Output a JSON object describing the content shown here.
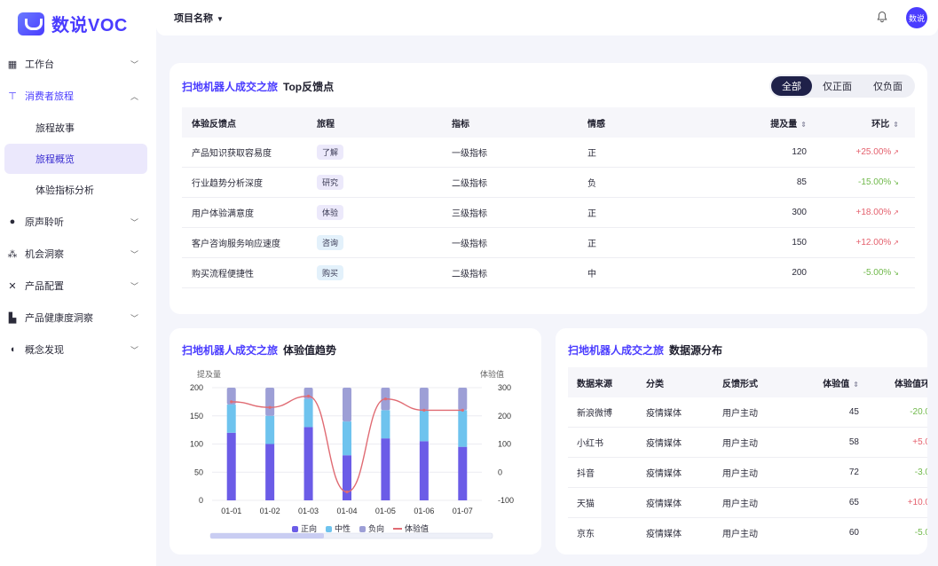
{
  "app": {
    "logo_text": "数说VOC"
  },
  "header": {
    "project_label": "项目名称",
    "avatar_text": "数说"
  },
  "sidebar": {
    "items": [
      {
        "label": "工作台",
        "icon": "dashboard-icon"
      },
      {
        "label": "消费者旅程",
        "icon": "signpost-icon",
        "expanded": true,
        "children": [
          {
            "label": "旅程故事"
          },
          {
            "label": "旅程概览",
            "active": true
          },
          {
            "label": "体验指标分析"
          }
        ]
      },
      {
        "label": "原声聆听",
        "icon": "chat-icon"
      },
      {
        "label": "机会洞察",
        "icon": "network-icon"
      },
      {
        "label": "产品配置",
        "icon": "tools-icon"
      },
      {
        "label": "产品健康度洞察",
        "icon": "building-icon"
      },
      {
        "label": "概念发现",
        "icon": "bulb-icon"
      }
    ]
  },
  "feedback_card": {
    "title_highlight": "扫地机器人成交之旅",
    "title_rest": "Top反馈点",
    "filters": [
      "全部",
      "仅正面",
      "仅负面"
    ],
    "active_filter": "全部",
    "columns": [
      "体验反馈点",
      "旅程",
      "指标",
      "情感",
      "提及量",
      "环比"
    ],
    "rows": [
      {
        "point": "产品知识获取容易度",
        "journey": "了解",
        "metric": "一级指标",
        "sentiment": "正",
        "mentions": "120",
        "mom": "+25.00%",
        "dir": "up"
      },
      {
        "point": "行业趋势分析深度",
        "journey": "研究",
        "metric": "二级指标",
        "sentiment": "负",
        "mentions": "85",
        "mom": "-15.00%",
        "dir": "down"
      },
      {
        "point": "用户体验满意度",
        "journey": "体验",
        "metric": "三级指标",
        "sentiment": "正",
        "mentions": "300",
        "mom": "+18.00%",
        "dir": "up"
      },
      {
        "point": "客户咨询服务响应速度",
        "journey": "咨询",
        "metric": "一级指标",
        "sentiment": "正",
        "mentions": "150",
        "mom": "+12.00%",
        "dir": "up"
      },
      {
        "point": "购买流程便捷性",
        "journey": "购买",
        "metric": "二级指标",
        "sentiment": "中",
        "mentions": "200",
        "mom": "-5.00%",
        "dir": "down"
      }
    ]
  },
  "trend_card": {
    "title_highlight": "扫地机器人成交之旅",
    "title_rest": "体验值趋势"
  },
  "chart_data": {
    "type": "bar",
    "stacked": true,
    "categories": [
      "01-01",
      "01-02",
      "01-03",
      "01-04",
      "01-05",
      "01-06",
      "01-07"
    ],
    "series": [
      {
        "name": "正向",
        "values": [
          120,
          100,
          130,
          80,
          110,
          105,
          95
        ],
        "color": "#6b5ce7"
      },
      {
        "name": "中性",
        "values": [
          50,
          50,
          50,
          60,
          50,
          55,
          65
        ],
        "color": "#6ec3ee"
      },
      {
        "name": "负向",
        "values": [
          30,
          50,
          20,
          60,
          40,
          40,
          40
        ],
        "color": "#9d9fd6"
      },
      {
        "name": "体验值",
        "type": "line",
        "axis": "right",
        "values": [
          250,
          230,
          270,
          -70,
          260,
          220,
          220
        ],
        "color": "#e06b73"
      }
    ],
    "ylabel": "提及量",
    "ylabel_right": "体验值",
    "ylim": [
      0,
      200
    ],
    "ylim_right": [
      -100,
      300
    ],
    "yticks": [
      "0",
      "50",
      "100",
      "150",
      "200"
    ],
    "yticks_right": [
      "-100",
      "0",
      "100",
      "200",
      "300"
    ],
    "grid": true,
    "legend": "bottom"
  },
  "source_card": {
    "title_highlight": "扫地机器人成交之旅",
    "title_rest": "数据源分布",
    "columns": [
      "数据来源",
      "分类",
      "反馈形式",
      "体验值",
      "体验值环"
    ],
    "rows": [
      {
        "source": "新浪微博",
        "category": "疫情媒体",
        "form": "用户主动",
        "value": "45",
        "mom": "-20.0",
        "dir": "down"
      },
      {
        "source": "小红书",
        "category": "疫情媒体",
        "form": "用户主动",
        "value": "58",
        "mom": "+5.0",
        "dir": "up"
      },
      {
        "source": "抖音",
        "category": "疫情媒体",
        "form": "用户主动",
        "value": "72",
        "mom": "-3.0",
        "dir": "down"
      },
      {
        "source": "天猫",
        "category": "疫情媒体",
        "form": "用户主动",
        "value": "65",
        "mom": "+10.0",
        "dir": "up"
      },
      {
        "source": "京东",
        "category": "疫情媒体",
        "form": "用户主动",
        "value": "60",
        "mom": "-5.0",
        "dir": "down"
      }
    ]
  }
}
